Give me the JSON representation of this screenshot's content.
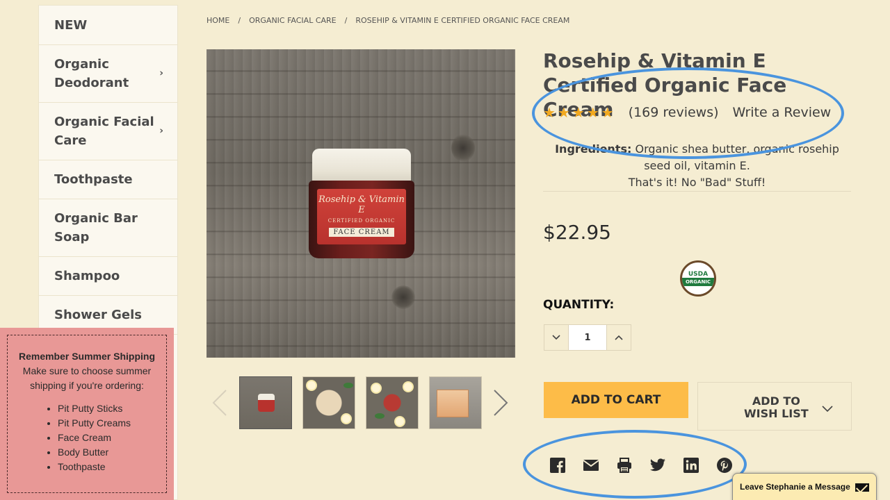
{
  "sidebar": {
    "items": [
      {
        "label": "NEW",
        "has_children": false
      },
      {
        "label": "Organic Deodorant",
        "has_children": true
      },
      {
        "label": "Organic Facial Care",
        "has_children": true
      },
      {
        "label": "Toothpaste",
        "has_children": false
      },
      {
        "label": "Organic Bar Soap",
        "has_children": false
      },
      {
        "label": "Shampoo",
        "has_children": false
      },
      {
        "label": "Shower Gels",
        "has_children": false
      }
    ],
    "chevron": "›"
  },
  "notice": {
    "title": "Remember Summer Shipping",
    "body": "Make sure to choose summer shipping if you're ordering:",
    "items": [
      "Pit Putty Sticks",
      "Pit Putty Creams",
      "Face Cream",
      "Body Butter",
      "Toothpaste"
    ]
  },
  "breadcrumb": {
    "items": [
      "HOME",
      "ORGANIC FACIAL CARE",
      "ROSEHIP & VITAMIN E CERTIFIED ORGANIC FACE CREAM"
    ],
    "separator": "/"
  },
  "product_image": {
    "label_line1": "Rosehip & Vitamin E",
    "label_line2": "CERTIFIED ORGANIC",
    "label_line3": "FACE CREAM"
  },
  "gallery": {
    "prev_icon": "chevron-left-icon",
    "next_icon": "chevron-right-icon",
    "active_index": 0
  },
  "product": {
    "title": "Rosehip & Vitamin E Certified Organic Face Cream",
    "rating": 5,
    "stars": "★★★★★",
    "review_count": "(169 reviews)",
    "write_review": "Write a Review",
    "ingredients_label": "Ingredients:",
    "ingredients_text": " Organic shea butter, organic rosehip seed oil, vitamin E.",
    "ingredients_note": "That's it! No \"Bad\" Stuff!",
    "price": "$22.95",
    "usda_top": "USDA",
    "usda_bottom": "ORGANIC",
    "quantity_label": "QUANTITY:",
    "quantity_value": "1",
    "add_to_cart": "ADD TO CART",
    "wishlist_line1": "ADD TO",
    "wishlist_line2": "WISH LIST"
  },
  "share": {
    "icons": [
      "facebook-icon",
      "email-icon",
      "print-icon",
      "twitter-icon",
      "linkedin-icon",
      "pinterest-icon"
    ]
  },
  "message_tab": {
    "label": "Leave Stephanie a Message"
  },
  "colors": {
    "page_bg": "#f5edd2",
    "accent_button": "#fdbc48",
    "star": "#f2a91f",
    "annotation": "#4a94de",
    "notice_bg": "#e89896"
  }
}
